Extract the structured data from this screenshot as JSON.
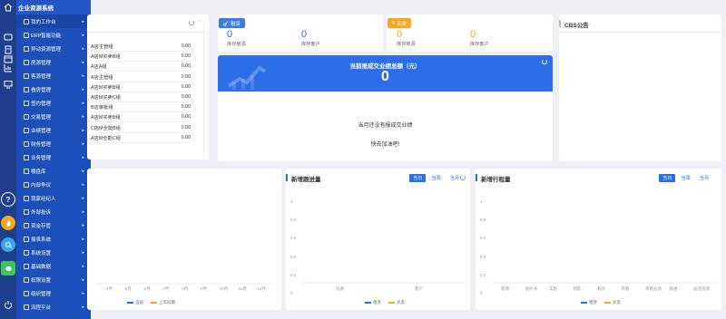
{
  "app": {
    "title": "企业资源系统"
  },
  "colors": {
    "menu_bg": "#1e4fb8",
    "rail_bg": "#1d3f8e",
    "accent": "#2b6ee8",
    "orange": "#f5a623",
    "blue_badge": "#3b7be9"
  },
  "rail": {
    "icons": [
      "home-icon",
      "message-icon",
      "document-icon",
      "calendar-icon",
      "chart-icon",
      "monitor-icon",
      "help-icon",
      "fire-icon",
      "search-icon",
      "wechat-icon",
      "power-icon"
    ]
  },
  "menu": {
    "items": [
      {
        "label": "我的工作台"
      },
      {
        "label": "ERP智能功能"
      },
      {
        "label": "异动资源管理"
      },
      {
        "label": "房源管理"
      },
      {
        "label": "客源管理"
      },
      {
        "label": "看房管理"
      },
      {
        "label": "签约管理"
      },
      {
        "label": "交易管理"
      },
      {
        "label": "业绩管理"
      },
      {
        "label": "财务管理"
      },
      {
        "label": "业务管理"
      },
      {
        "label": "楼盘库"
      },
      {
        "label": "内部争议"
      },
      {
        "label": "我家经纪人"
      },
      {
        "label": "外部投诉"
      },
      {
        "label": "资金存管"
      },
      {
        "label": "报表系统"
      },
      {
        "label": "系统设置"
      },
      {
        "label": "基础数据"
      },
      {
        "label": "权限设置"
      },
      {
        "label": "组织管理"
      },
      {
        "label": "流程平台"
      }
    ]
  },
  "list_card": {
    "rows": [
      {
        "name": "A店主管组",
        "value": "0.00"
      },
      {
        "name": "A店M买卖B组",
        "value": "0.00"
      },
      {
        "name": "A店A组",
        "value": "0.00"
      },
      {
        "name": "A店主管组",
        "value": "0.00"
      },
      {
        "name": "A店M买卖B组",
        "value": "0.00"
      },
      {
        "name": "A店M买卖C组",
        "value": "0.00"
      },
      {
        "name": "B店审批组",
        "value": "0.00"
      },
      {
        "name": "A店M买卖B组",
        "value": "0.00"
      },
      {
        "name": "C店M全能B组",
        "value": "0.00"
      },
      {
        "name": "A店M全能C组",
        "value": "0.00"
      }
    ]
  },
  "rent_card": {
    "badge": "租赁",
    "stats": [
      {
        "value": "0",
        "label": "库存房源"
      },
      {
        "value": "0",
        "label": "库存客户"
      }
    ]
  },
  "sale_card": {
    "badge": "买卖",
    "stats": [
      {
        "value": "0",
        "label": "库存房源"
      },
      {
        "value": "0",
        "label": "库存客户"
      }
    ]
  },
  "cbs_card": {
    "title": "CBS公告"
  },
  "performance_card": {
    "title": "当前报成交业绩总额（元）",
    "total": "0",
    "empty_line1": "当月还没有报成交业绩",
    "empty_line2": "快去加油吧!"
  },
  "chart_left": {
    "x_labels": [
      "4月",
      "5月",
      "6月",
      "7月",
      "8月",
      "9月",
      "10月",
      "11月",
      "12月"
    ],
    "legend": [
      {
        "name": "当前",
        "color": "#2b6ee8"
      },
      {
        "name": "上年同期",
        "color": "#f5a623"
      }
    ]
  },
  "chart_follow": {
    "title": "新增跟进量",
    "tabs": [
      "当日",
      "当周",
      "当月"
    ],
    "y_labels": [
      "1",
      "0.8",
      "0.6",
      "0.4",
      "0.2",
      "0"
    ],
    "x_labels": [
      "房源",
      "客户"
    ],
    "legend": [
      {
        "name": "租赁",
        "color": "#2b6ee8"
      },
      {
        "name": "买卖",
        "color": "#f5a623"
      }
    ]
  },
  "chart_trip": {
    "title": "新增行程量",
    "tabs": [
      "当日",
      "当周",
      "当月"
    ],
    "y_labels": [
      "1",
      "0.8",
      "0.6",
      "0.4",
      "0.2",
      "0"
    ],
    "x_labels": [
      "新增",
      "委托书",
      "实勘",
      "钥匙",
      "看房",
      "带看",
      "审看业绩",
      "跟进",
      "返还房源"
    ],
    "legend": [
      {
        "name": "租赁",
        "color": "#2b6ee8"
      },
      {
        "name": "买卖",
        "color": "#f5a623"
      }
    ]
  }
}
